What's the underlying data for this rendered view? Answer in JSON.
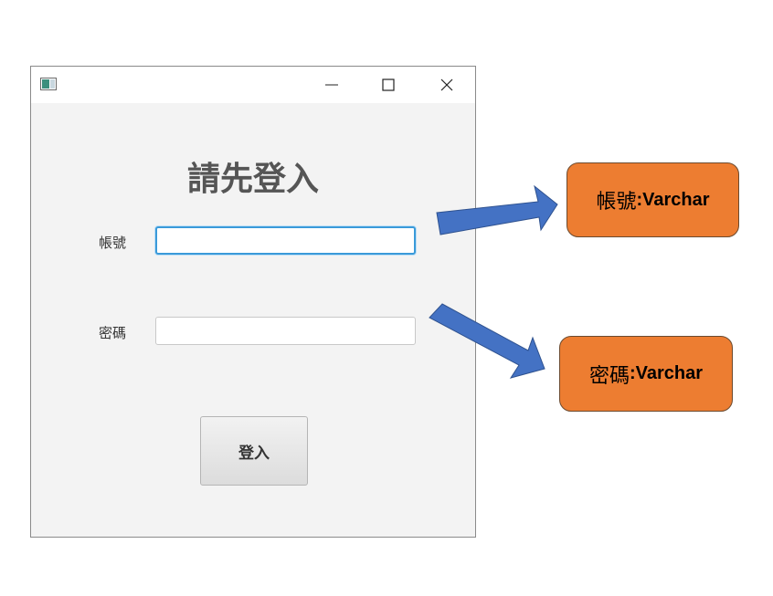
{
  "window": {
    "minimize_glyph": "—",
    "heading": "請先登入"
  },
  "form": {
    "username_label": "帳號",
    "username_value": "",
    "password_label": "密碼",
    "password_value": "",
    "login_button_label": "登入"
  },
  "annotations": [
    {
      "field": "帳號",
      "separator": ": ",
      "type": "Varchar"
    },
    {
      "field": "密碼",
      "separator": ": ",
      "type": "Varchar"
    }
  ],
  "colors": {
    "callout_fill": "#ed7d31",
    "arrow_fill": "#4472c4",
    "focus_border": "#3a9ad9"
  }
}
